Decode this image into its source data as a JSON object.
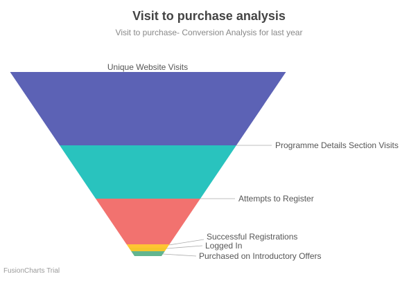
{
  "header": {
    "title": "Visit to purchase analysis",
    "subtitle": "Visit to purchase- Conversion Analysis for last year"
  },
  "watermark": "FusionCharts Trial",
  "chart_data": {
    "type": "funnel",
    "title": "Visit to purchase analysis",
    "subtitle": "Visit to purchase- Conversion Analysis for last year",
    "stages": [
      {
        "label": "Unique Website Visits",
        "value": 1000,
        "color": "#5c62b5"
      },
      {
        "label": "Programme Details Section Visits",
        "value": 690,
        "color": "#29c3be"
      },
      {
        "label": "Attempts to Register",
        "value": 440,
        "color": "#f2726f"
      },
      {
        "label": "Successful Registrations",
        "value": 135,
        "color": "#ffc533"
      },
      {
        "label": "Logged In",
        "value": 125,
        "color": "#f5c72c"
      },
      {
        "label": "Purchased on Introductory Offers",
        "value": 95,
        "color": "#62b58f"
      }
    ]
  }
}
